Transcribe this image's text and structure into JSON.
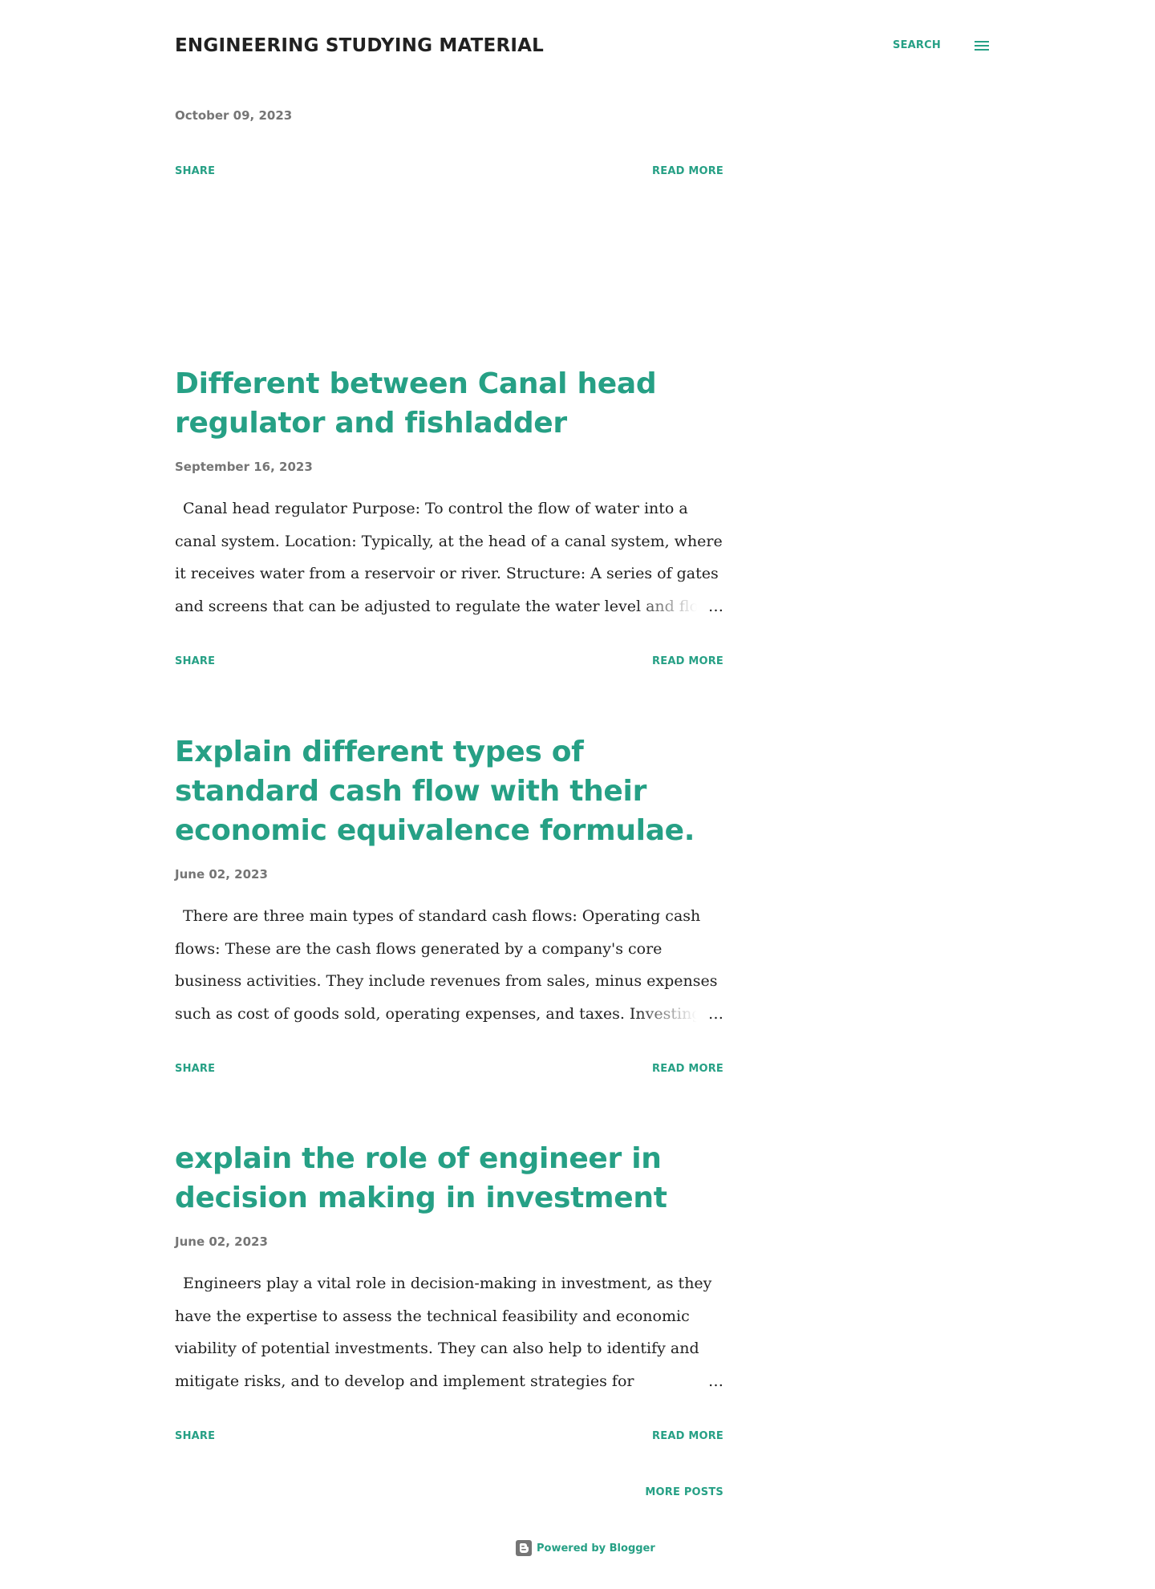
{
  "header": {
    "blog_title": "ENGINEERING STUDYING MATERIAL",
    "search_label": "SEARCH",
    "menu_icon": "hamburger-menu-icon"
  },
  "posts": [
    {
      "title": "",
      "date": "October 09, 2023",
      "snippet": "",
      "share_label": "SHARE",
      "read_more_label": "READ MORE"
    },
    {
      "title": "Different between Canal head regulator and fishladder",
      "date": "September 16, 2023",
      "snippet": "Canal head regulator Purpose: To control the flow of water into a canal system. Location: Typically, at the head of a canal system, where it receives water from a reservoir or river. Structure: A series of gates and screens that can be adjusted to regulate the water level and flow rate.",
      "share_label": "SHARE",
      "read_more_label": "READ MORE"
    },
    {
      "title": "Explain different types of standard cash flow with their economic equivalence formulae.",
      "date": "June 02, 2023",
      "snippet": "There are three main types of standard cash flows: Operating cash flows: These are the cash flows generated by a company's core business activities. They include revenues from sales, minus expenses such as cost of goods sold, operating expenses, and taxes. Investing cash flows",
      "share_label": "SHARE",
      "read_more_label": "READ MORE"
    },
    {
      "title": "explain the role of engineer in decision making in investment",
      "date": "June 02, 2023",
      "snippet": "Engineers play a vital role in decision-making in investment, as they have the expertise to assess the technical feasibility and economic viability of potential investments. They can also help to identify and mitigate risks, and to develop and implement strategies for maximizing",
      "share_label": "SHARE",
      "read_more_label": "READ MORE"
    }
  ],
  "ellipsis": "…",
  "more_posts_label": "MORE POSTS",
  "footer": {
    "powered_by_label": "Powered by Blogger",
    "icon": "blogger-icon"
  },
  "colors": {
    "accent": "#26a085",
    "text": "#212121",
    "date": "#757575",
    "background": "#ffffff"
  }
}
